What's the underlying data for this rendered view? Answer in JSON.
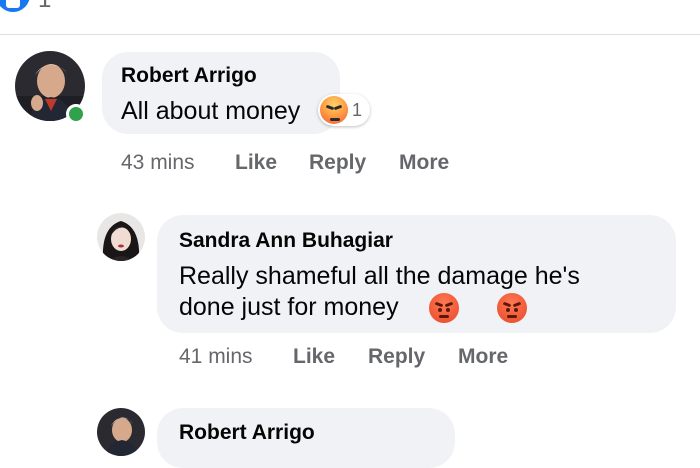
{
  "top": {
    "reaction_count": "1",
    "reaction_icon": "like-icon"
  },
  "comments": [
    {
      "author": "Robert Arrigo",
      "text": "All about money",
      "reaction_count": "1",
      "time": "43 mins",
      "actions": {
        "like": "Like",
        "reply": "Reply",
        "more": "More"
      }
    },
    {
      "author": "Sandra Ann Buhagiar",
      "text_line1": "Really shameful all the damage he's",
      "text_line2": "done just for money",
      "time": "41 mins",
      "actions": {
        "like": "Like",
        "reply": "Reply",
        "more": "More"
      }
    },
    {
      "author": "Robert Arrigo"
    }
  ],
  "colors": {
    "bubble": "#f0f2f5",
    "meta": "#65676b",
    "online": "#31a24c",
    "brand": "#1877f2"
  }
}
